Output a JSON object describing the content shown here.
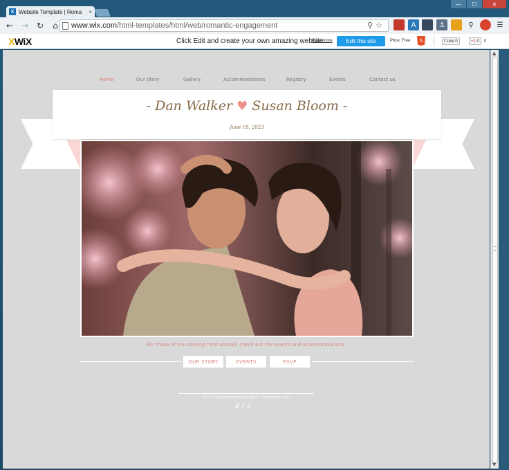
{
  "browser": {
    "tab_title": "Website Template | Roma",
    "tab_close": "×",
    "favicon": "X",
    "url_domain": "www.wix.com",
    "url_path": "/html-templates/html/web/romantic-engagement",
    "window_buttons": [
      "—",
      "☐",
      "✕"
    ],
    "nav_icons": [
      "back-arrow-icon",
      "forward-arrow-icon",
      "reload-icon",
      "home-icon"
    ]
  },
  "wix_bar": {
    "logo_x": "X",
    "logo_text": "WiX",
    "message": "Click Edit and create your own amazing website",
    "read_more": "Read more",
    "edit_button": "Edit this site",
    "price": "Price: Free",
    "fb_like": "Like",
    "fb_count": "0",
    "gplus": "+1",
    "gplus_count": "0",
    "extra_count": "0"
  },
  "site": {
    "nav": [
      "Home",
      "Our Story",
      "Gallery",
      "Accommodations",
      "Registry",
      "Events",
      "Contact us"
    ],
    "name_left": "- Dan Walker",
    "heart": "♥",
    "name_right": "Susan Bloom -",
    "date": "June 18, 2023",
    "tagline": "For those of you coming from abroad, check out the events and accommodations.",
    "buttons": [
      "OUR STORY",
      "EVENTS",
      "RSVP"
    ],
    "copyright": "© 2023 by Dan Walker Susan Bloom |   Webmaster Login"
  },
  "colors": {
    "accent": "#e0807a",
    "title": "#8a6a48",
    "page_bg": "#d9d9d9",
    "edit_button": "#1d9ae8"
  }
}
